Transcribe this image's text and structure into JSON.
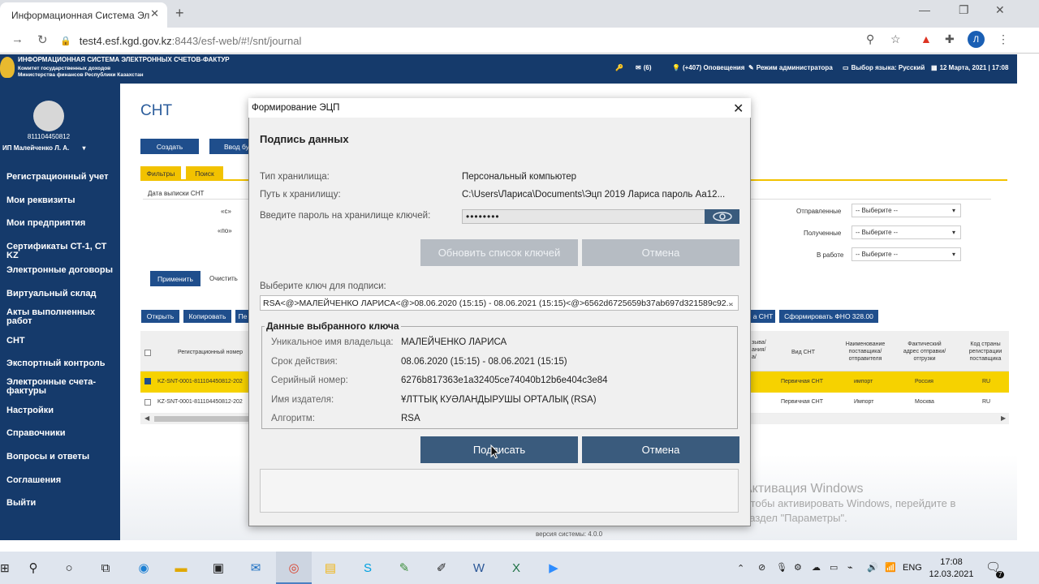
{
  "browser": {
    "tab_title": "Информационная Система Эл",
    "url_host": "test4.esf.kgd.gov.kz",
    "url_rest": ":8443/esf-web/#!/snt/journal",
    "avatar_letter": "Л"
  },
  "header": {
    "title": "ИНФОРМАЦИОННАЯ СИСТЕМА ЭЛЕКТРОННЫХ СЧЕТОВ-ФАКТУР",
    "subtitle1": "Комитет государственных доходов",
    "subtitle2": "Министерства финансов Республики Казахстан",
    "mail_count": "(6)",
    "notifications": "(+407) Оповещения",
    "admin_mode": "Режим администратора",
    "language": "Выбор языка: Русский",
    "datetime": "12 Марта, 2021 | 17:08"
  },
  "sidebar": {
    "user_id": "811104450812",
    "user_name": "ИП Малейченко Л. А.",
    "items": [
      {
        "label": "Регистрационный учет"
      },
      {
        "label": "Мои реквизиты"
      },
      {
        "label": "Мои предприятия"
      },
      {
        "label": "Сертификаты СТ-1, СТ KZ"
      },
      {
        "label": "Электронные договоры"
      },
      {
        "label": "Виртуальный склад"
      },
      {
        "label": "Акты выполненных работ"
      },
      {
        "label": "СНТ"
      },
      {
        "label": "Экспортный контроль"
      },
      {
        "label": "Электронные счета-фактуры"
      },
      {
        "label": "Настройки"
      },
      {
        "label": "Справочники"
      },
      {
        "label": "Вопросы и ответы"
      },
      {
        "label": "Соглашения"
      },
      {
        "label": "Выйти"
      }
    ]
  },
  "main": {
    "title": "СНТ",
    "create_btn": "Создать",
    "input_btn": "Ввод бу",
    "tab_filters": "Фильтры",
    "tab_search": "Поиск",
    "date_label": "Дата выписки СНТ",
    "from_label": "«с»",
    "to_label": "«по»",
    "apply_btn": "Применить",
    "clear_btn": "Очистить",
    "filter_sent": "Отправленные",
    "filter_received": "Полученные",
    "filter_work": "В работе",
    "select_placeholder": "-- Выберите --",
    "open_btn": "Открыть",
    "copy_btn": "Копировать",
    "third_btn": "Пе",
    "snt_btn": "а СНТ",
    "fno_btn": "Сформировать ФНО 328.00",
    "col_regnum": "Регистрационный номер",
    "col_partial": "зыва/ания/а/",
    "col_type": "Вид СНТ",
    "col_supplier": "Наименование поставщика/ отправителя",
    "col_address": "Фактический адрес отправки/ отгрузки",
    "col_country": "Код страны регистрации поставщика",
    "rows": [
      {
        "regnum": "KZ-SNT-0001-811104450812-202",
        "type": "Первичная СНТ",
        "supplier": "импорт",
        "address": "Россия",
        "country": "RU"
      },
      {
        "regnum": "KZ-SNT-0001-811104450812-202",
        "type": "Первичная СНТ",
        "supplier": "Импорт",
        "address": "Москва",
        "country": "RU"
      }
    ],
    "version": "версия системы: 4.0.0"
  },
  "windows_activation": {
    "title": "Активация Windows",
    "line1": "Чтобы активировать Windows, перейдите в",
    "line2": "раздел \"Параметры\"."
  },
  "dialog": {
    "title": "Формирование ЭЦП",
    "heading": "Подпись данных",
    "storage_type_label": "Тип хранилища:",
    "storage_type_value": "Персональный компьютер",
    "path_label": "Путь к хранилищу:",
    "path_value": "C:\\Users\\Лариса\\Documents\\Эцп 2019 Лариса пароль Аа12...",
    "password_label": "Введите пароль на хранилище ключей:",
    "password_value": "••••••••",
    "refresh_btn": "Обновить список ключей",
    "cancel_top_btn": "Отмена",
    "select_key_label": "Выберите ключ для подписи:",
    "select_key_value": "RSA<@>МАЛЕЙЧЕНКО ЛАРИСА<@>08.06.2020 (15:15) - 08.06.2021 (15:15)<@>6562d6725659b37ab697d321589c92...",
    "key_group_title": "Данные выбранного ключа",
    "owner_label": "Уникальное имя владельца:",
    "owner_value": "МАЛЕЙЧЕНКО ЛАРИСА",
    "validity_label": "Срок действия:",
    "validity_value": "08.06.2020 (15:15) - 08.06.2021 (15:15)",
    "serial_label": "Серийный номер:",
    "serial_value": "6276b817363e1a32405ce74040b12b6e404c3e84",
    "issuer_label": "Имя издателя:",
    "issuer_value": "ҰЛТТЫҚ КУӘЛАНДЫРУШЫ ОРТАЛЫҚ (RSA)",
    "algorithm_label": "Алгоритм:",
    "algorithm_value": "RSA",
    "sign_btn": "Подписать",
    "cancel_btn": "Отмена"
  },
  "taskbar": {
    "lang": "ENG",
    "time": "17:08",
    "date": "12.03.2021",
    "notif_count": "7"
  },
  "colors": {
    "header_bg": "#153a6b",
    "highlight_row": "#f6d200",
    "dialog_button": "#3a5b7d",
    "disabled_button": "#b6bcc3"
  }
}
